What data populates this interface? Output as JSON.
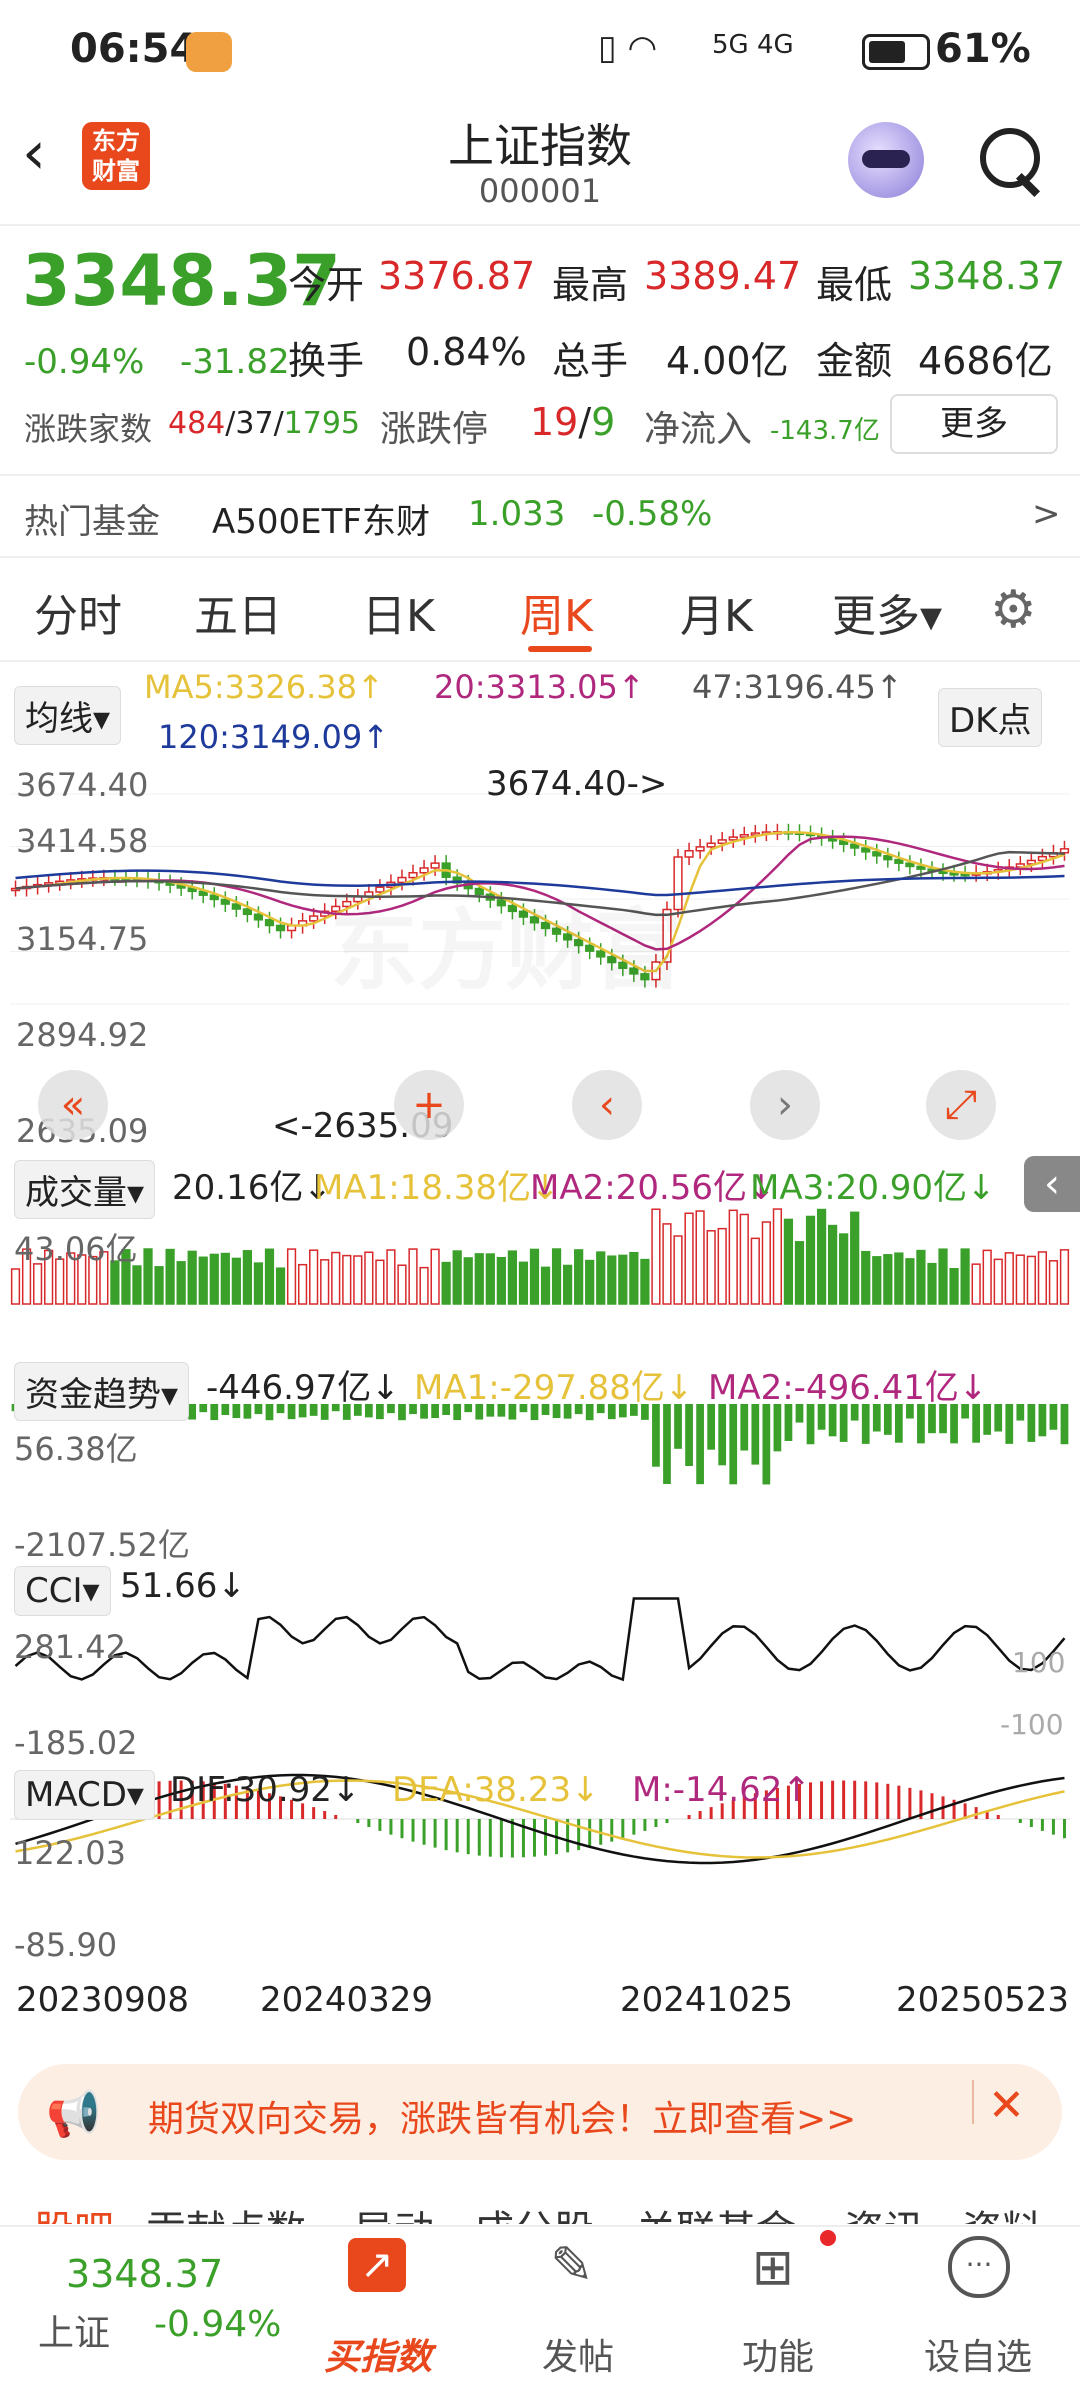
{
  "status": {
    "time": "06:54",
    "signal": "5G 4G",
    "battery": "61%"
  },
  "header": {
    "logo_text": "东方财富",
    "title": "上证指数",
    "code": "000001"
  },
  "quote": {
    "price": "3348.37",
    "change_pct": "-0.94%",
    "change": "-31.82",
    "open_label": "今开",
    "open": "3376.87",
    "high_label": "最高",
    "high": "3389.47",
    "low_label": "最低",
    "low": "3348.37",
    "turnover_label": "换手",
    "turnover": "0.84%",
    "volume_label": "总手",
    "volume": "4.00亿",
    "amount_label": "金额",
    "amount": "4686亿",
    "breadth_label": "涨跌家数",
    "breadth_up": "484",
    "breadth_flat": "37",
    "breadth_down": "1795",
    "limit_label": "涨跌停",
    "limit_up": "19",
    "limit_down": "9",
    "netflow_label": "净流入",
    "netflow": "-143.7亿",
    "more_label": "更多"
  },
  "hot_fund": {
    "label": "热门基金",
    "name": "A500ETF东财",
    "price": "1.033",
    "pct": "-0.58%",
    "arrow": ">"
  },
  "tabs": [
    {
      "label": "分时",
      "active": false
    },
    {
      "label": "五日",
      "active": false
    },
    {
      "label": "日K",
      "active": false
    },
    {
      "label": "周K",
      "active": true
    },
    {
      "label": "月K",
      "active": false
    },
    {
      "label": "更多▾",
      "active": false
    }
  ],
  "ma_legend": {
    "selector": "均线▾",
    "ma5": "MA5:3326.38↑",
    "ma20": "20:3313.05↑",
    "ma47": "47:3196.45↑",
    "ma120": "120:3149.09↑",
    "dk": "DK点"
  },
  "kchart": {
    "ticks": [
      "3674.40",
      "3414.58",
      "3154.75",
      "2894.92",
      "2635.09"
    ],
    "max_label": "3674.40->",
    "min_label": "<-2635.09",
    "watermark": "东方财富"
  },
  "volume": {
    "selector": "成交量▾",
    "value": "20.16亿↓",
    "ma1": "MA1:18.38亿↓",
    "ma2": "MA2:20.56亿↓",
    "ma3": "MA3:20.90亿↓",
    "tick_top": "43.06亿"
  },
  "fund_trend": {
    "selector": "资金趋势▾",
    "value": "-446.97亿↓",
    "ma1": "MA1:-297.88亿↓",
    "ma2": "MA2:-496.41亿↓",
    "tick_top": "56.38亿",
    "tick_bottom": "-2107.52亿"
  },
  "cci": {
    "selector": "CCI▾",
    "value": "51.66↓",
    "tick_top": "281.42",
    "tick_bottom": "-185.02",
    "ref_high": "100",
    "ref_low": "-100"
  },
  "macd": {
    "selector": "MACD▾",
    "dif": "DIF:30.92↓",
    "dea": "DEA:38.23↓",
    "m": "M:-14.62↑",
    "tick_top": "122.03",
    "tick_bottom": "-85.90"
  },
  "dates": [
    "20230908",
    "20240329",
    "20241025",
    "20250523"
  ],
  "banner": {
    "text": "期货双向交易，涨跌皆有机会！立即查看>>"
  },
  "subtabs": [
    "股吧",
    "贡献点数",
    "异动",
    "成分股",
    "关联基金",
    "资讯",
    "资料"
  ],
  "bottom": {
    "index_price": "3348.37",
    "index_name": "上证",
    "index_pct": "-0.94%",
    "buy_label": "买指数",
    "post_label": "发帖",
    "func_label": "功能",
    "watch_label": "设自选"
  },
  "colors": {
    "up": "#d8282a",
    "down": "#3aa02a",
    "accent": "#e8481c",
    "ma5": "#e6c23a",
    "ma20": "#b0287e",
    "ma47": "#555555",
    "ma120": "#1e3a9a"
  }
}
